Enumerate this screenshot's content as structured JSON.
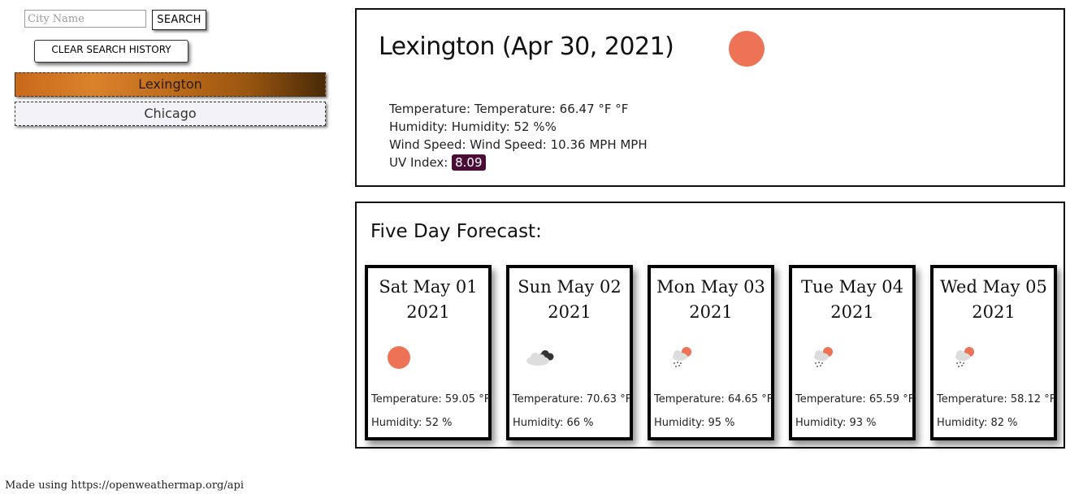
{
  "search": {
    "placeholder": "City Name",
    "value": "",
    "button_label": "SEARCH"
  },
  "clear_history_label": "CLEAR SEARCH HISTORY",
  "history": [
    {
      "label": "Lexington",
      "active": true
    },
    {
      "label": "Chicago",
      "active": false
    }
  ],
  "current": {
    "title": "Lexington (Apr 30, 2021)",
    "icon": "sun-icon",
    "temperature": "Temperature: Temperature: 66.47 °F °F",
    "humidity": "Humidity: Humidity: 52 %%",
    "wind": "Wind Speed: Wind Speed: 10.36 MPH MPH",
    "uv_label": "UV Index: ",
    "uv_value": "8.09",
    "uv_color": "#4a0e36"
  },
  "forecast": {
    "title": "Five Day Forecast:",
    "days": [
      {
        "date_line1": "Sat May 01",
        "date_line2": "2021",
        "icon": "sun-icon",
        "temp": "Temperature: 59.05 °F",
        "humidity": "Humidity: 52 %"
      },
      {
        "date_line1": "Sun May 02",
        "date_line2": "2021",
        "icon": "cloud-icon",
        "temp": "Temperature: 70.63 °F",
        "humidity": "Humidity: 66 %"
      },
      {
        "date_line1": "Mon May 03",
        "date_line2": "2021",
        "icon": "rain-sun-icon",
        "temp": "Temperature: 64.65 °F",
        "humidity": "Humidity: 95 %"
      },
      {
        "date_line1": "Tue May 04",
        "date_line2": "2021",
        "icon": "rain-sun-icon",
        "temp": "Temperature: 65.59 °F",
        "humidity": "Humidity: 93 %"
      },
      {
        "date_line1": "Wed May 05",
        "date_line2": "2021",
        "icon": "rain-sun-icon",
        "temp": "Temperature: 58.12 °F",
        "humidity": "Humidity: 82 %"
      }
    ]
  },
  "footer": "Made using https://openweathermap.org/api",
  "colors": {
    "sun": "#ee7255",
    "active_history": "#c9691a"
  }
}
